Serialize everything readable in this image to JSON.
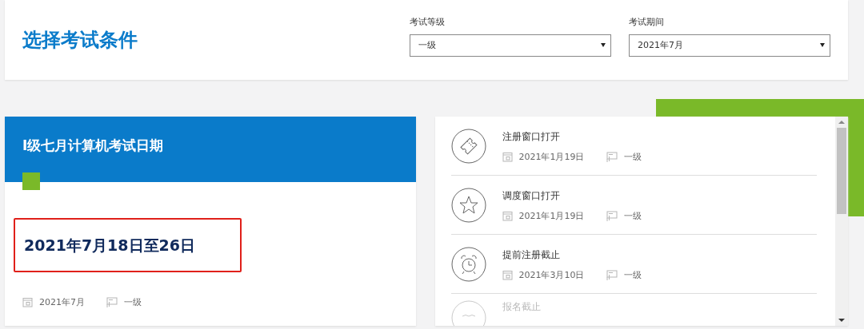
{
  "header": {
    "title": "选择考试条件",
    "filters": [
      {
        "label": "考试等级",
        "value": "一级"
      },
      {
        "label": "考试期间",
        "value": "2021年7月"
      }
    ]
  },
  "exam_card": {
    "title": "I级七月计算机考试日期",
    "date": "2021年7月18日至26日",
    "highlighted": true,
    "period": "2021年7月",
    "level": "一级"
  },
  "milestones": [
    {
      "kind": "ticket",
      "title": "注册窗口打开",
      "date": "2021年1月19日",
      "level": "一级",
      "faded": false
    },
    {
      "kind": "star",
      "title": "调度窗口打开",
      "date": "2021年1月19日",
      "level": "一级",
      "faded": false
    },
    {
      "kind": "alarm",
      "title": "提前注册截止",
      "date": "2021年3月10日",
      "level": "一级",
      "faded": false
    },
    {
      "kind": "other",
      "title": "报名截止",
      "faded": true
    }
  ]
}
